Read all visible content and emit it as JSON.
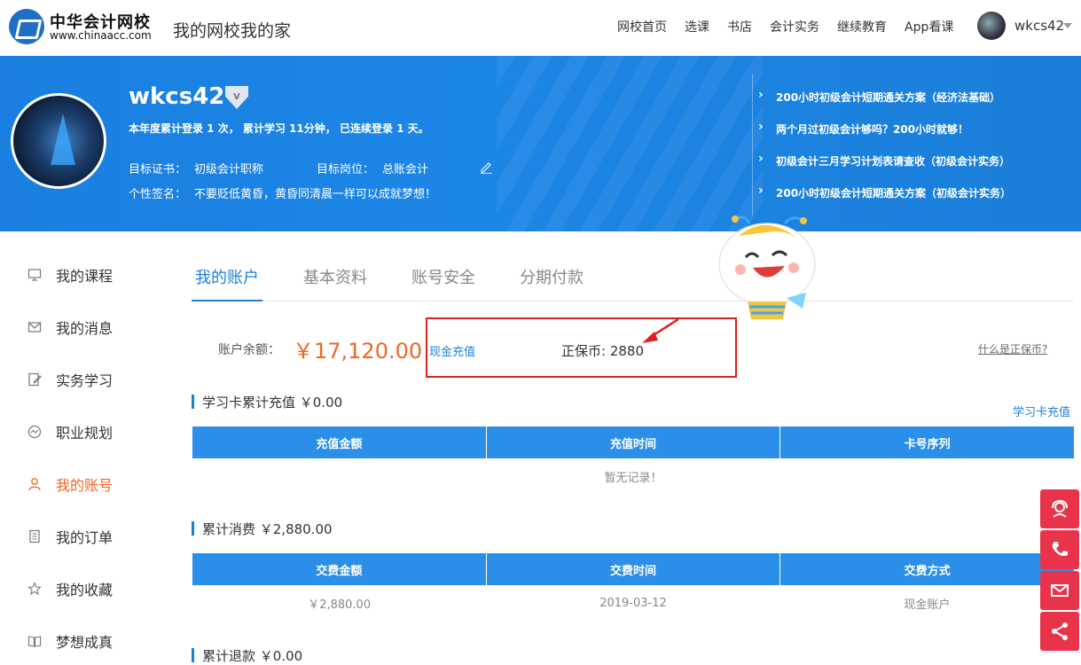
{
  "header": {
    "logo_cn": "中华会计网校",
    "logo_en": "www.chinaacc.com",
    "slogan": "我的网校我的家",
    "nav": [
      "网校首页",
      "选课",
      "书店",
      "会计实务",
      "继续教育",
      "App看课"
    ],
    "username": "wkcs42"
  },
  "profile": {
    "username": "wkcs42",
    "badge": "V",
    "stats": "本年度累计登录 1 次， 累计学习 11分钟， 已连续登录 1 天。",
    "target_cert_label": "目标证书：",
    "target_cert": "初级会计职称",
    "target_post_label": "目标岗位：",
    "target_post": "总账会计",
    "signature_label": "个性签名：",
    "signature": "不要贬低黄昏，黄昏同清晨一样可以成就梦想！"
  },
  "news": [
    "200小时初级会计短期通关方案（经济法基础）",
    "两个月过初级会计够吗？200小时就够！",
    "初级会计三月学习计划表请查收（初级会计实务）",
    "200小时初级会计短期通关方案（初级会计实务）"
  ],
  "sidebar": {
    "items": [
      {
        "label": "我的课程",
        "icon": "monitor-icon"
      },
      {
        "label": "我的消息",
        "icon": "envelope-icon"
      },
      {
        "label": "实务学习",
        "icon": "edit-doc-icon"
      },
      {
        "label": "职业规划",
        "icon": "chart-circle-icon"
      },
      {
        "label": "我的账号",
        "icon": "user-icon"
      },
      {
        "label": "我的订单",
        "icon": "document-icon"
      },
      {
        "label": "我的收藏",
        "icon": "star-icon"
      },
      {
        "label": "梦想成真",
        "icon": "book-icon"
      }
    ],
    "active_color": "#f26522"
  },
  "tabs": [
    "我的账户",
    "基本资料",
    "账号安全",
    "分期付款"
  ],
  "account": {
    "balance_label": "账户余额：",
    "balance": "￥17,120.00",
    "recharge": "现金充值",
    "coin": "正保币: 2880",
    "what_coin": "什么是正保币?"
  },
  "card_section": {
    "title": "学习卡累计充值 ￥0.00",
    "link": "学习卡充值",
    "headers": [
      "充值金额",
      "充值时间",
      "卡号序列"
    ],
    "empty": "暂无记录！"
  },
  "spend_section": {
    "title": "累计消费 ￥2,880.00",
    "headers": [
      "交费金额",
      "交费时间",
      "交费方式"
    ],
    "rows": [
      [
        "￥2,880.00",
        "2019-03-12",
        "现金账户"
      ]
    ]
  },
  "refund_section": {
    "title": "累计退款 ￥0.00"
  },
  "colors": {
    "brand_blue": "#1c7fd9",
    "accent_orange": "#f26522",
    "highlight_red": "#e02020",
    "float_red": "#e8334a"
  }
}
